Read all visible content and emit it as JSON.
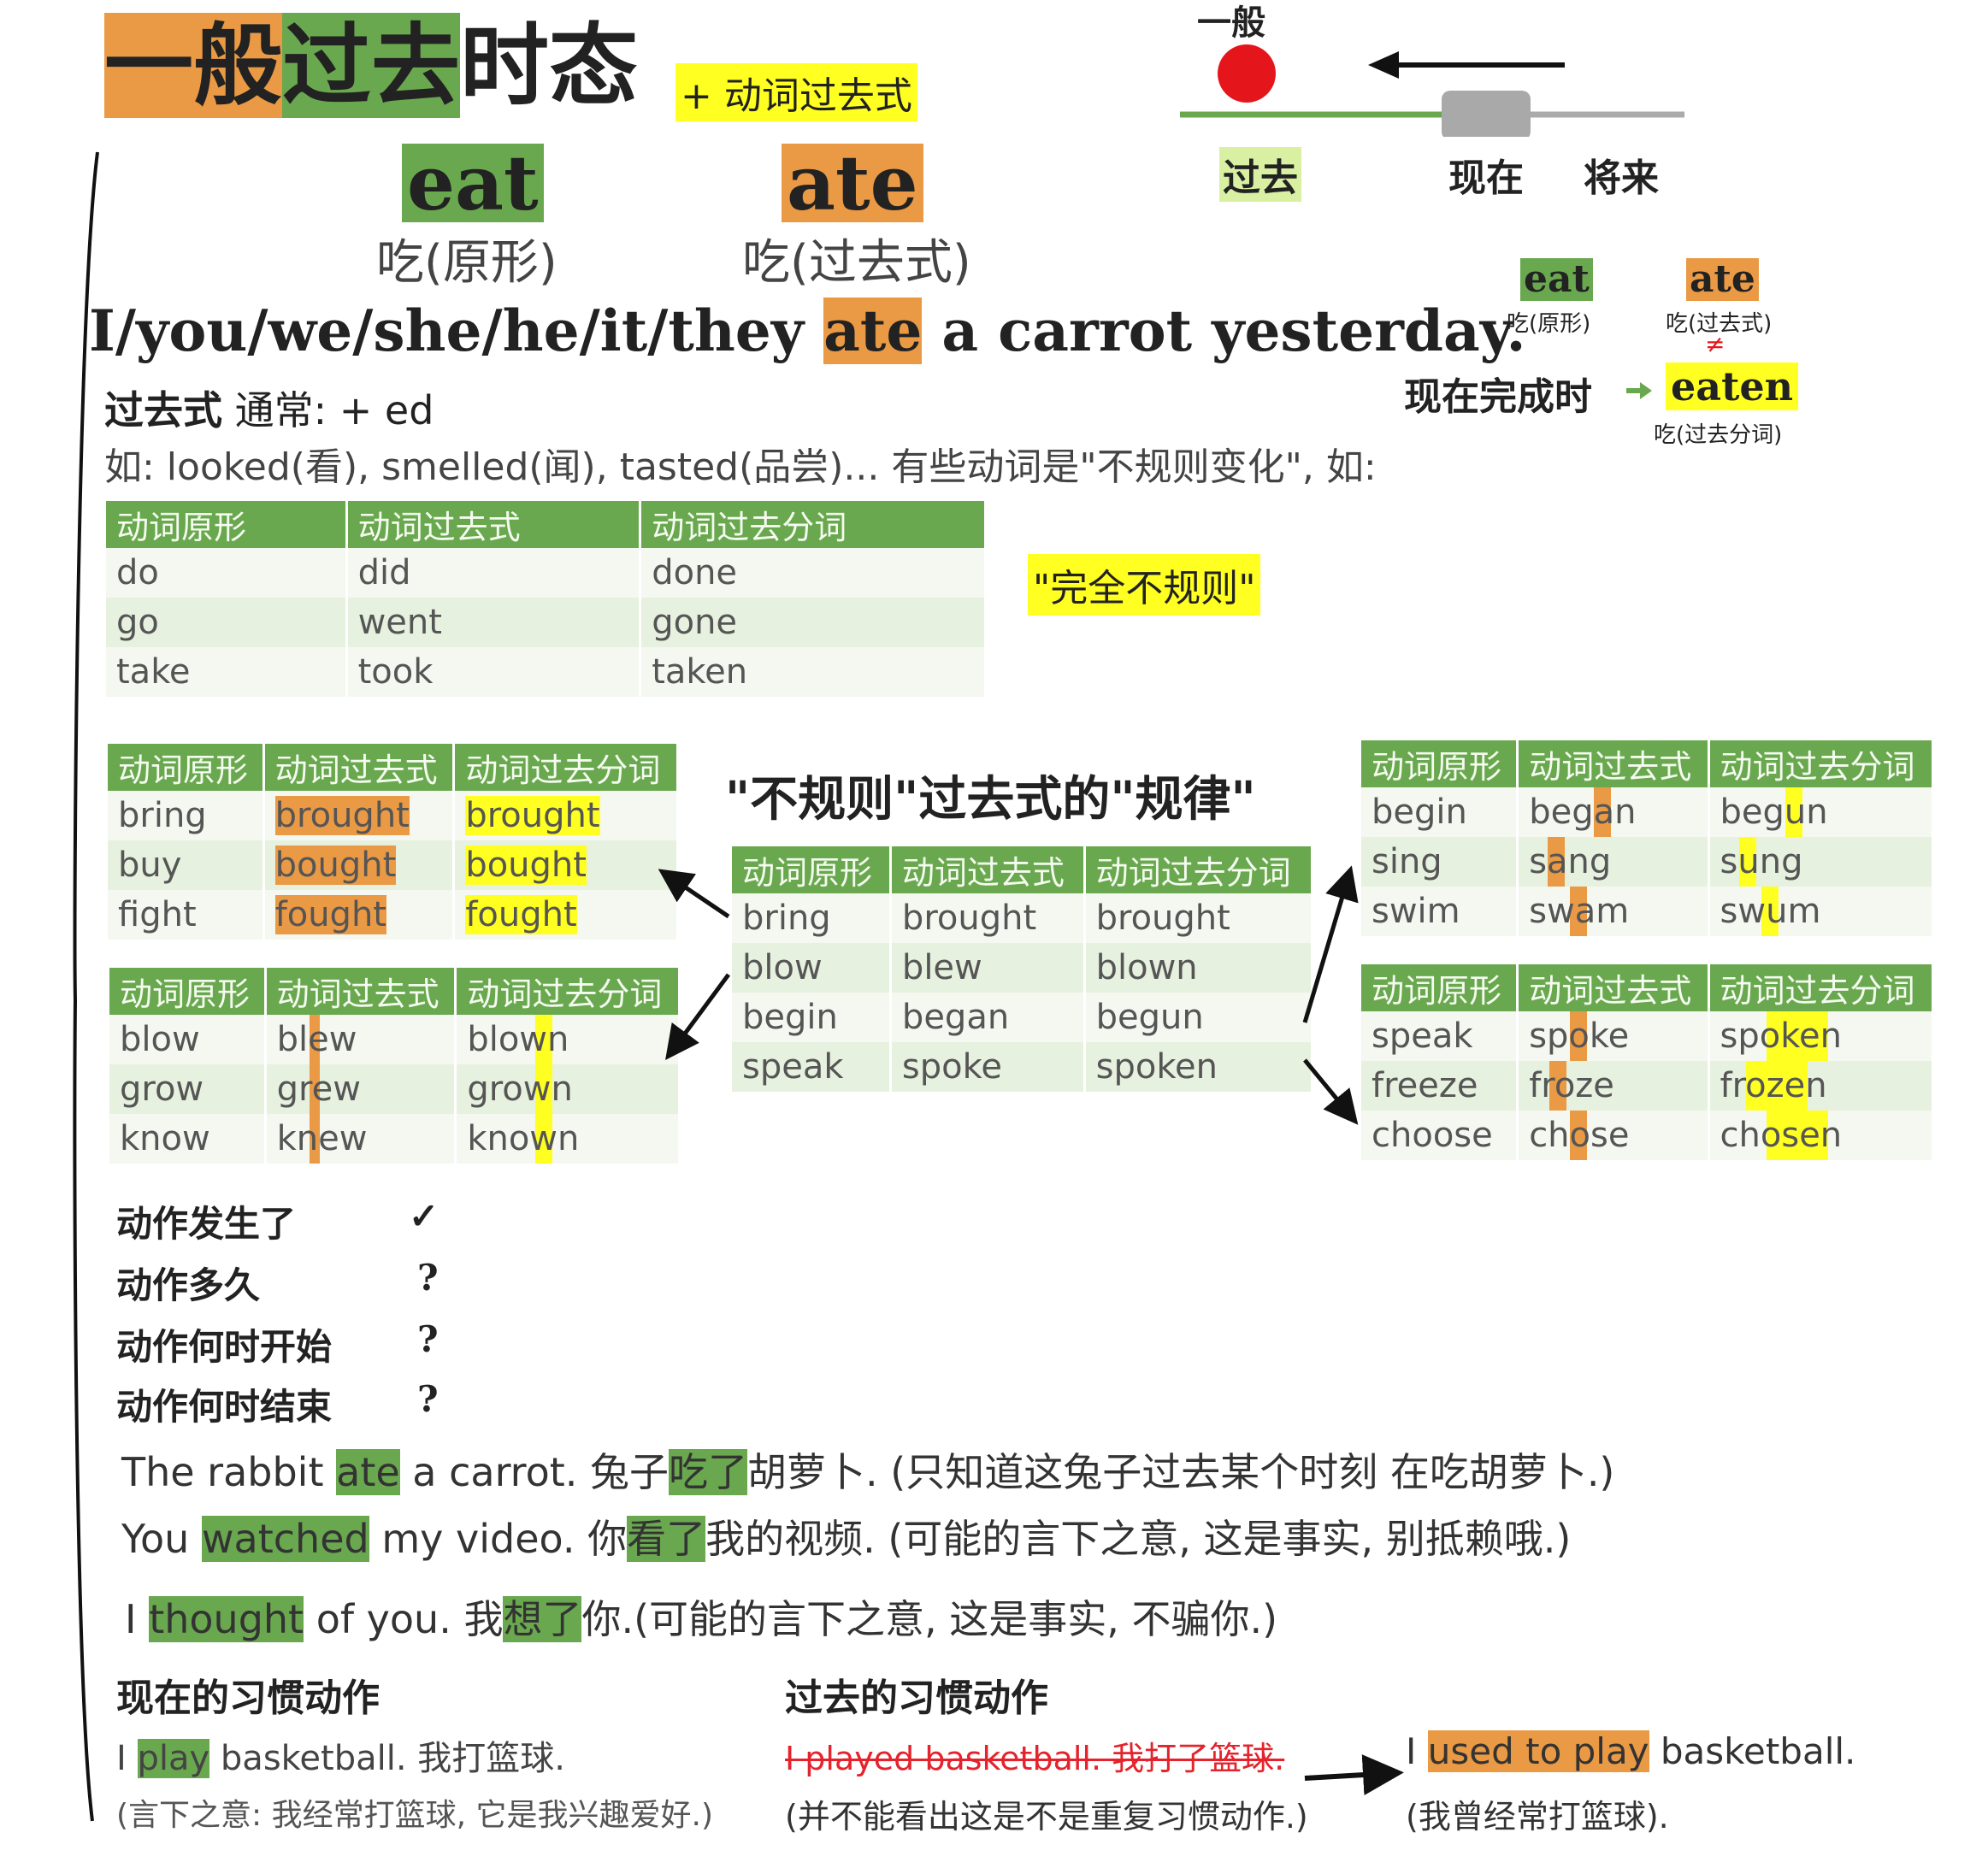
{
  "title": {
    "part1": "一般",
    "part2": "过去",
    "part3": "时态"
  },
  "formula_tag": "+ 动词过去式",
  "big_forms": {
    "eat": "eat",
    "eat_note": "吃(原形)",
    "ate": "ate",
    "ate_note": "吃(过去式)"
  },
  "timeline": {
    "general": "一般",
    "past": "过去",
    "present": "现在",
    "future": "将来"
  },
  "side_box": {
    "eat": "eat",
    "eat_note": "吃(原形)",
    "ate": "ate",
    "ate_note": "吃(过去式)",
    "neq": "≠",
    "perfect": "现在完成时",
    "eaten": "eaten",
    "eaten_note": "吃(过去分词)"
  },
  "main_sentence": {
    "before": "I/you/we/she/he/it/they ",
    "verb": "ate",
    "after": " a carrot yesterday."
  },
  "rule": {
    "label": "过去式",
    "text": " 通常: + ed"
  },
  "examples_line": "如: looked(看), smelled(闻), tasted(品尝)...   有些动词是\"不规则变化\", 如:",
  "headers": [
    "动词原形",
    "动词过去式",
    "动词过去分词"
  ],
  "irregular_label": "\"完全不规则\"",
  "table_irregular": [
    [
      "do",
      "did",
      "done"
    ],
    [
      "go",
      "went",
      "gone"
    ],
    [
      "take",
      "took",
      "taken"
    ]
  ],
  "pattern_title": "\"不规则\"过去式的\"规律\"",
  "table_center": [
    [
      "bring",
      "brought",
      "brought"
    ],
    [
      "blow",
      "blew",
      "blown"
    ],
    [
      "begin",
      "began",
      "begun"
    ],
    [
      "speak",
      "spoke",
      "spoken"
    ]
  ],
  "table_ought": [
    [
      "bring",
      "brought",
      "brought"
    ],
    [
      "buy",
      "bought",
      "bought"
    ],
    [
      "fight",
      "fought",
      "fought"
    ]
  ],
  "table_ew": [
    [
      "blow",
      "blew",
      "blown"
    ],
    [
      "grow",
      "grew",
      "grown"
    ],
    [
      "know",
      "knew",
      "known"
    ]
  ],
  "table_vowel": [
    [
      "begin",
      "began",
      "begun"
    ],
    [
      "sing",
      "sang",
      "sung"
    ],
    [
      "swim",
      "swam",
      "swum"
    ]
  ],
  "table_o": [
    [
      "speak",
      "spoke",
      "spoken"
    ],
    [
      "freeze",
      "froze",
      "frozen"
    ],
    [
      "choose",
      "chose",
      "chosen"
    ]
  ],
  "questions": [
    {
      "q": "动作发生了",
      "a": "✓"
    },
    {
      "q": "动作多久",
      "a": "?"
    },
    {
      "q": "动作何时开始",
      "a": "?"
    },
    {
      "q": "动作何时结束",
      "a": "?"
    }
  ],
  "ex1": {
    "a": "The rabbit ",
    "v": "ate",
    "b": " a carrot. 兔子",
    "c": "吃了",
    "d": "胡萝卜. (只知道这兔子过去某个时刻 在吃胡萝卜.)"
  },
  "ex2": {
    "a": "You ",
    "v": "watched",
    "b": " my video. 你",
    "c": "看了",
    "d": "我的视频. (可能的言下之意, 这是事实, 别抵赖哦.)"
  },
  "ex3": {
    "a": "I ",
    "v": "thought",
    "b": " of you. 我",
    "c": "想了",
    "d": "你.(可能的言下之意, 这是事实, 不骗你.)"
  },
  "habit_now": {
    "title": "现在的习惯动作",
    "a": "I ",
    "v": "play",
    "b": " basketball. 我打篮球.",
    "note": "(言下之意: 我经常打篮球, 它是我兴趣爱好.)"
  },
  "habit_past": {
    "title": "过去的习惯动作",
    "struck": "I played basketball. 我打了篮球.",
    "note": "(并不能看出这是不是重复习惯动作.)",
    "a": "I ",
    "v": "used to play",
    "b": " basketball.",
    "note2": "(我曾经常打篮球)."
  },
  "colors": {
    "orange": "#ea9a45",
    "green": "#6aa84f",
    "yellow": "#ffff22",
    "red": "#e4161b",
    "strike": "#e4232c"
  }
}
